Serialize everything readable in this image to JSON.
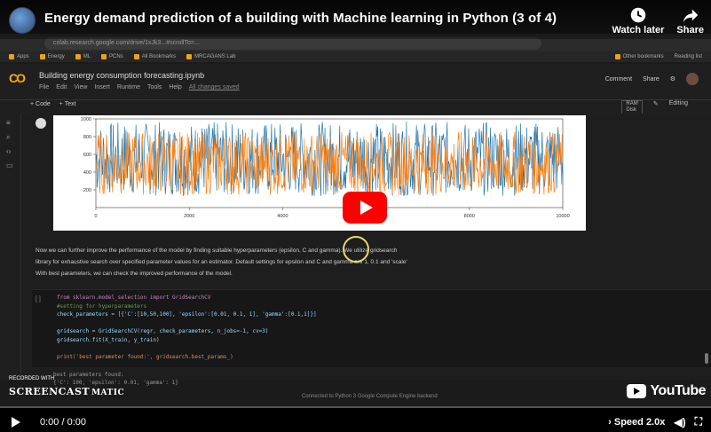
{
  "video": {
    "title": "Energy demand prediction of a building with Machine learning in Python (3 of 4)",
    "watch_later_label": "Watch later",
    "share_label": "Share",
    "current_time": "0:00 / 0:00",
    "speed_label": "Speed",
    "speed_value": "2.0x",
    "progress": 0
  },
  "browser": {
    "url": "colab.research.google.com/drive/1xJk3...#scrollTo=...",
    "bookmarks": [
      "Apps",
      "Energy",
      "ML",
      "PCNs",
      "All Bookmarks",
      "MRCAGANS Lab"
    ],
    "other_bookmarks": "Other bookmarks",
    "reading_list": "Reading list"
  },
  "colab": {
    "notebook_name": "Building energy consumption forecasting.ipynb",
    "menu": [
      "File",
      "Edit",
      "View",
      "Insert",
      "Runtime",
      "Tools",
      "Help",
      "All changes saved"
    ],
    "comment_label": "Comment",
    "share_label": "Share",
    "add_code": "+ Code",
    "add_text": "+ Text",
    "ram_label": "RAM",
    "disk_label": "Disk",
    "editing_label": "Editing"
  },
  "text_cell": {
    "line1": "Now we can further improve the performance of the model by finding suitable hyperparameters (epsilon, C and gamma). We utilize gridsearch",
    "line2": "library for exhaustive search over specified parameter values for an estimator. Default settings for epsilon and C and gamma are 1, 0.1 and 'scale'",
    "line3": "With best parameters, we can check the improved performance of the model."
  },
  "code_cell": {
    "bracket": "[ ]",
    "l1": "from sklearn.model_selection import GridSearchCV",
    "l2": "#setting for hyperparameters",
    "l3": "check_parameters = [{'C':[10,50,100], 'epsilon':[0.01, 0.1, 1], 'gamma':[0.1,1]}]",
    "l4": "gridsearch = GridSearchCV(regr, check_parameters, n_jobs=-1, cv=3)",
    "l5": "gridsearch.fit(X_train, y_train)",
    "l6": "print('best parameter found:', gridsearch.best_params_)"
  },
  "output": {
    "l1": "best parameters found:",
    "l2": "{'C': 100, 'epsilon': 0.01, 'gamma': 1}",
    "status": "Connected to Python 3 Google Compute Engine backend"
  },
  "watermark": {
    "small": "RECORDED WITH",
    "big": "SCREENCAST",
    "suffix": "MATIC"
  },
  "youtube_logo": "YouTube",
  "chart_data": {
    "type": "line",
    "series_colors": [
      "#1f77b4",
      "#ff7f0e"
    ],
    "x_ticks": [
      "0",
      "2000",
      "4000",
      "6000",
      "8000",
      "10000"
    ],
    "xlim": [
      0,
      10000
    ],
    "ylim": [
      0,
      1000
    ],
    "y_ticks": [
      "200",
      "400",
      "600",
      "800",
      "1000"
    ],
    "note_colors": "blue series mostly hidden under orange series"
  }
}
